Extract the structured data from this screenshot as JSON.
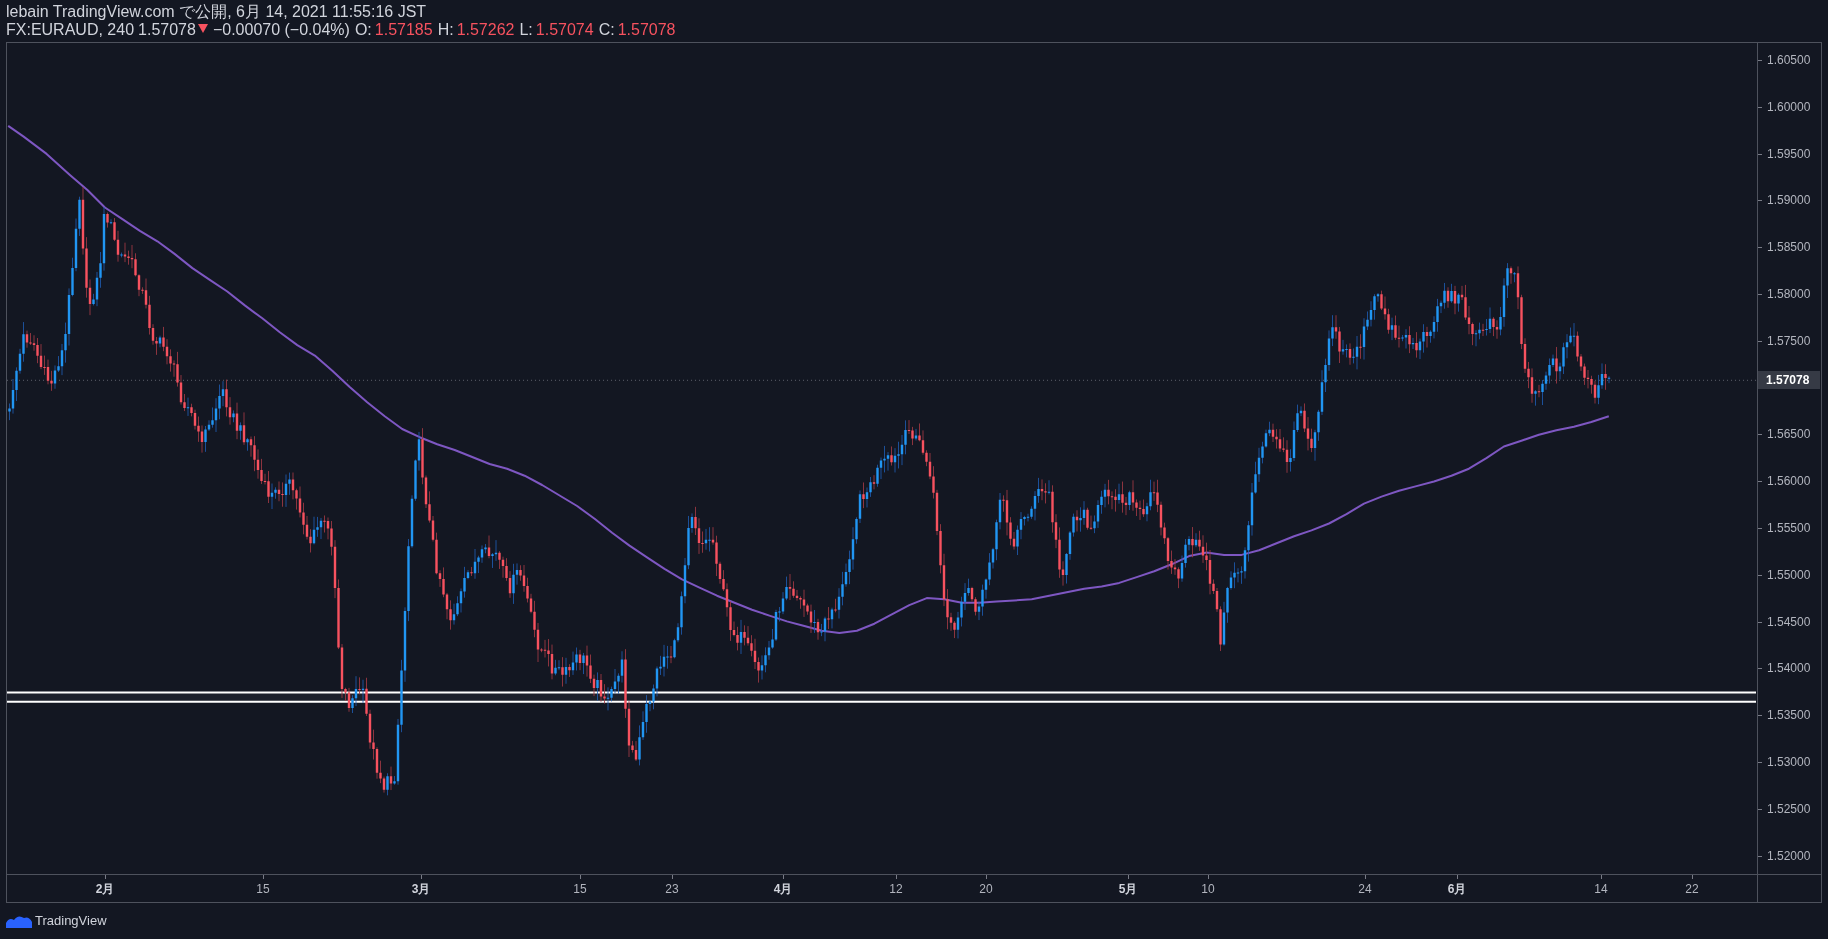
{
  "header": {
    "published": "lebain TradingView.com で公開, 6月 14, 2021 11:55:16 JST",
    "symbol": "FX:EURAUD, 240",
    "last": "1.57078",
    "falling": true,
    "change": "−0.00070 (−0.04%)",
    "ohlc": [
      {
        "label": "O:",
        "value": "1.57185"
      },
      {
        "label": "H:",
        "value": "1.57262"
      },
      {
        "label": "L:",
        "value": "1.57074"
      },
      {
        "label": "C:",
        "value": "1.57078"
      }
    ]
  },
  "price_axis": {
    "ticks": [
      "1.60500",
      "1.60000",
      "1.59500",
      "1.59000",
      "1.58500",
      "1.58000",
      "1.57500",
      "1.56500",
      "1.56000",
      "1.55500",
      "1.55000",
      "1.54500",
      "1.54000",
      "1.53500",
      "1.53000",
      "1.52500",
      "1.52000"
    ],
    "current_price": "1.57078"
  },
  "time_axis": {
    "ticks": [
      {
        "label": "2月",
        "kind": "month"
      },
      {
        "label": "15",
        "kind": "day"
      },
      {
        "label": "3月",
        "kind": "month"
      },
      {
        "label": "15",
        "kind": "day"
      },
      {
        "label": "23",
        "kind": "day"
      },
      {
        "label": "4月",
        "kind": "month"
      },
      {
        "label": "12",
        "kind": "day"
      },
      {
        "label": "20",
        "kind": "day"
      },
      {
        "label": "5月",
        "kind": "month"
      },
      {
        "label": "10",
        "kind": "day"
      },
      {
        "label": "24",
        "kind": "day"
      },
      {
        "label": "6月",
        "kind": "month"
      },
      {
        "label": "14",
        "kind": "day"
      },
      {
        "label": "22",
        "kind": "day"
      }
    ]
  },
  "footer": {
    "brand": "TradingView"
  }
}
